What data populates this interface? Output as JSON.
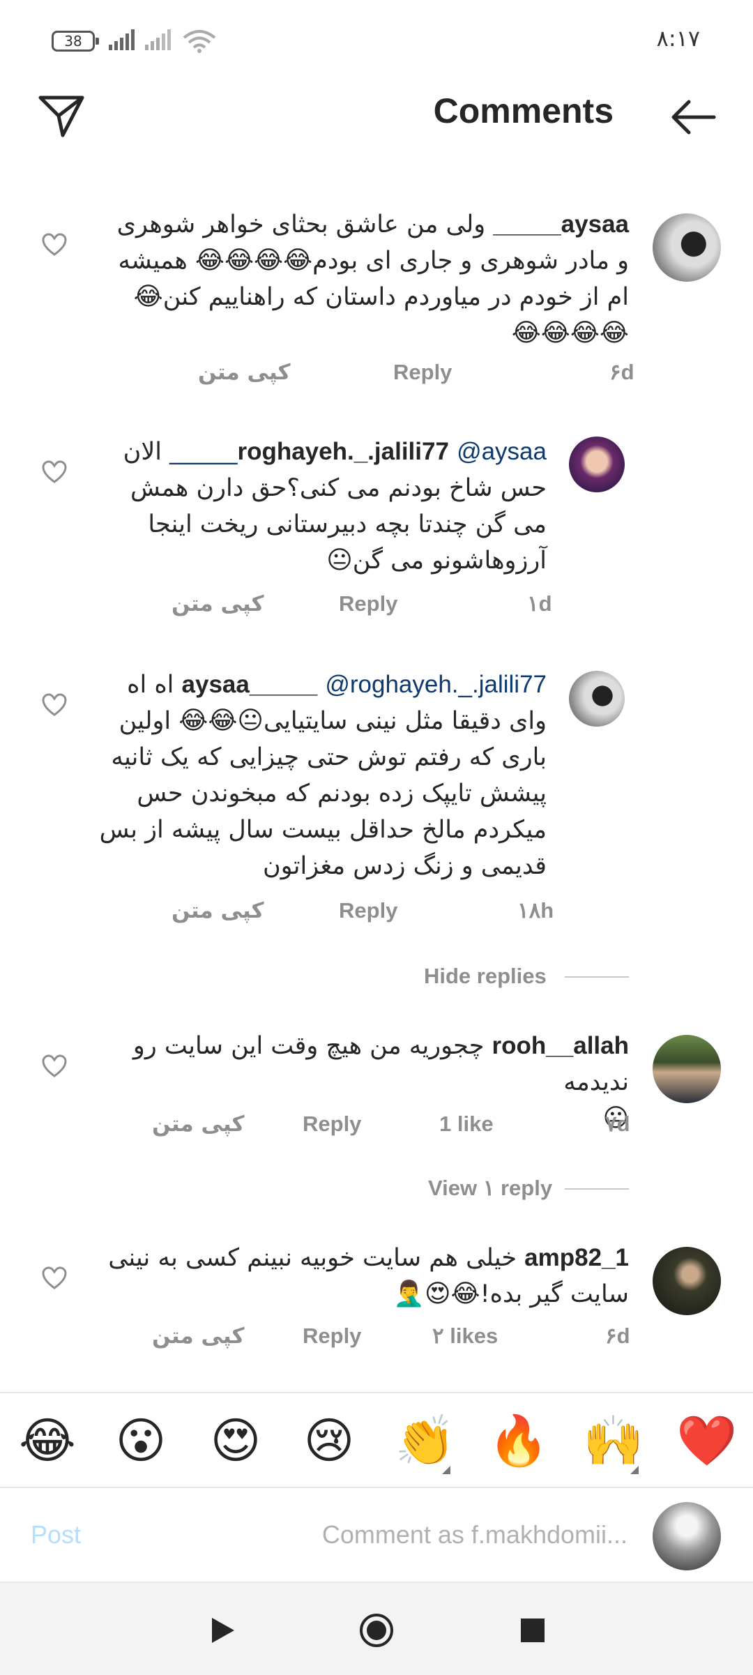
{
  "status_bar": {
    "battery": "38",
    "time": "۸:۱۷"
  },
  "header": {
    "title": "Comments",
    "back_icon": "arrow-left-icon",
    "share_icon": "send-icon"
  },
  "comments": [
    {
      "username": "aysaa_____",
      "parts": [
        "ولی من عاشق بحثای خواهر شوهری و مادر شوهری و جاری ای بودم",
        "😂😂😂😂",
        " همیشه ام از خودم در میاوردم داستان که راهناییم کنن",
        "😂😂😂😂😂"
      ],
      "time": "۶d",
      "reply": "Reply",
      "copy": "کپی متن",
      "likes": ""
    },
    {
      "username": "roghayeh._.jalili77",
      "mention": "@aysaa_____",
      "parts": [
        " الان حس شاخ بودنم می کنی؟حق دارن همش می گن چندتا بچه دبیرستانی ریخت اینجا آرزوهاشونو می گن",
        "😐"
      ],
      "time": "۱d",
      "reply": "Reply",
      "copy": "کپی متن"
    },
    {
      "username": "aysaa_____",
      "mention": "@roghayeh._.jalili77",
      "parts": [
        " اه اه وای دقیقا مثل نینی سایتیایی",
        "😐😂😂",
        " اولین باری که رفتم توش حتی چیزایی که یک ثانیه پیشش تایپک زده بودنم که مبخوندن حس میکردم مالخ حداقل بیست سال پیشه از بس قدیمی و زنگ زدس مغزاتون"
      ],
      "time": "۱۸h",
      "reply": "Reply",
      "copy": "کپی متن"
    },
    {
      "username": "rooh__allah",
      "parts": [
        " چجوریه من هیچ وقت این سایت رو ندیدمه",
        "😐"
      ],
      "time": "۷d",
      "reply": "Reply",
      "copy": "کپی متن",
      "likes": "1 like"
    },
    {
      "username": "amp82_1",
      "parts": [
        " خیلی هم سایت خوبیه نبینم کسی به نینی سایت گیر بده!",
        "😂😍🤦‍♂️"
      ],
      "time": "۶d",
      "reply": "Reply",
      "copy": "کپی متن",
      "likes": "۲ likes"
    }
  ],
  "hide_replies": "Hide replies",
  "view_replies": "View ۱ reply",
  "emoji_bar": [
    "❤️",
    "🙌",
    "🔥",
    "👏",
    "😢",
    "😍",
    "😮",
    "😂"
  ],
  "input": {
    "placeholder": "Comment as f.makhdomii...",
    "post_label": "Post"
  },
  "nav": {
    "back": "play-triangle-icon",
    "home": "circle-home-icon",
    "recents": "square-recents-icon"
  },
  "colors": {
    "accent": "#0095f6",
    "post_disabled": "#b2dffc",
    "mention": "#0d3a6e",
    "meta": "#8e8e8e"
  }
}
